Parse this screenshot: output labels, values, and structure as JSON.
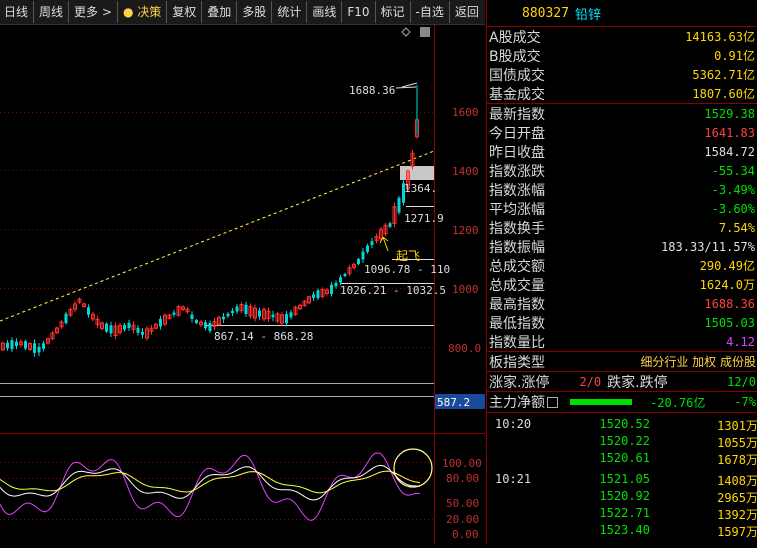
{
  "toolbar": {
    "items": [
      "日线",
      "周线",
      "更多",
      "决策",
      "复权",
      "叠加",
      "多股",
      "统计",
      "画线",
      "F10",
      "标记",
      "-自选",
      "返回"
    ]
  },
  "chart": {
    "y_axis_labels": [
      "1600",
      "1400",
      "1200",
      "1000",
      "800.0"
    ],
    "annotations": {
      "peak": "1688.36",
      "price1": "1364.",
      "price2": "1271.9",
      "takeoff": "起飞",
      "range1": "1096.78 - 110",
      "range2": "1026.21 - 1032.5",
      "range3": "867.14 - 868.28",
      "volume_label": "587.2"
    },
    "indicator_axis_labels": [
      "100.00",
      "80.00",
      "50.00",
      "20.00",
      "0.00"
    ]
  },
  "header": {
    "code": "880327",
    "name": "铅锌"
  },
  "stats": [
    {
      "label": "A股成交",
      "value": "14163.63亿",
      "color": "#ffd700"
    },
    {
      "label": "B股成交",
      "value": "0.91亿",
      "color": "#ffd700"
    },
    {
      "label": "国债成交",
      "value": "5362.71亿",
      "color": "#ffd700"
    },
    {
      "label": "基金成交",
      "value": "1807.60亿",
      "color": "#ffd700"
    },
    {
      "label": "最新指数",
      "value": "1529.38",
      "color": "#00e000"
    },
    {
      "label": "今日开盘",
      "value": "1641.83",
      "color": "#ff4040"
    },
    {
      "label": "昨日收盘",
      "value": "1584.72",
      "color": "#e0e0e0"
    },
    {
      "label": "指数涨跌",
      "value": "-55.34",
      "color": "#00e000"
    },
    {
      "label": "指数涨幅",
      "value": "-3.49%",
      "color": "#00e000"
    },
    {
      "label": "平均涨幅",
      "value": "-3.60%",
      "color": "#00e000"
    },
    {
      "label": "指数换手",
      "value": "7.54%",
      "color": "#ffd700"
    },
    {
      "label": "指数振幅",
      "value": "183.33/11.57%",
      "color": "#e0e0e0"
    },
    {
      "label": "总成交额",
      "value": "290.49亿",
      "color": "#ffd700"
    },
    {
      "label": "总成交量",
      "value": "1624.0万",
      "color": "#ffd700"
    },
    {
      "label": "最高指数",
      "value": "1688.36",
      "color": "#ff4040"
    },
    {
      "label": "最低指数",
      "value": "1505.03",
      "color": "#00e000"
    },
    {
      "label": "指数量比",
      "value": "4.12",
      "color": "#e040ff"
    }
  ],
  "board": {
    "label": "板指类型",
    "tags": "细分行业 加权 成份股"
  },
  "updown": {
    "label1": "涨家.涨停",
    "value1": "2/0",
    "label2": "跌家.跌停",
    "value2": "12/0"
  },
  "mainflow": {
    "label": "主力净额",
    "value": "-20.76亿",
    "pct": "-7%"
  },
  "ticks": [
    {
      "time": "10:20",
      "price": "1520.52",
      "vol": "1301万"
    },
    {
      "time": "",
      "price": "1520.22",
      "vol": "1055万"
    },
    {
      "time": "",
      "price": "1520.61",
      "vol": "1678万"
    },
    {
      "time": "10:21",
      "price": "1521.05",
      "vol": "1408万"
    },
    {
      "time": "",
      "price": "1520.92",
      "vol": "2965万"
    },
    {
      "time": "",
      "price": "1522.71",
      "vol": "1392万"
    },
    {
      "time": "",
      "price": "1523.40",
      "vol": "1597万"
    }
  ]
}
